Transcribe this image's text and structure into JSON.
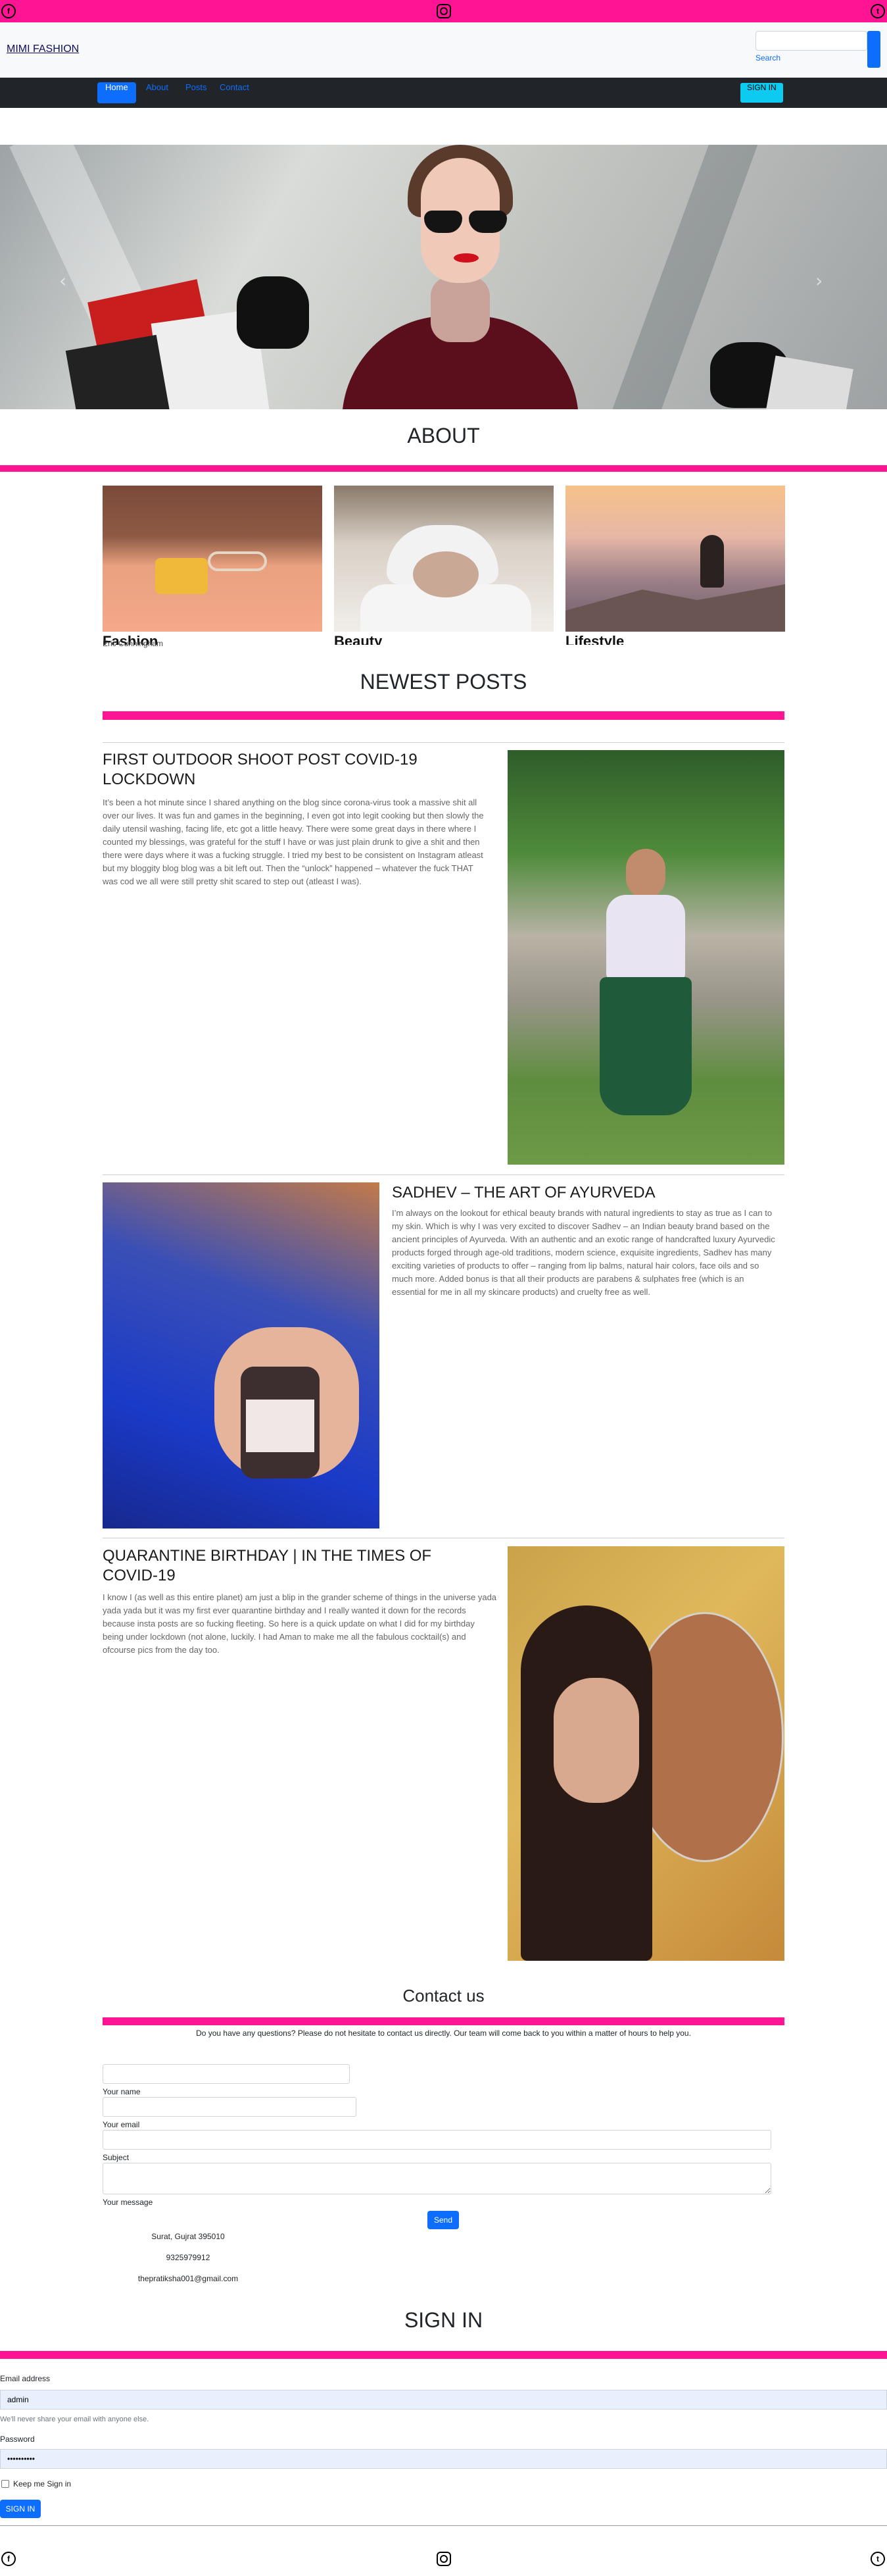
{
  "social": {
    "facebook": "f",
    "twitter": "t"
  },
  "brand": "MIMI FASHION",
  "search": {
    "label": "Search",
    "placeholder": ""
  },
  "nav": {
    "items": [
      "Home",
      "About",
      "Posts",
      "Contact"
    ],
    "signin": "SIGN IN"
  },
  "hero": {
    "prev": "‹",
    "next": "›"
  },
  "about": {
    "title": "ABOUT",
    "cards": [
      {
        "caption": "Fashion",
        "author": "Eric Cunningham"
      },
      {
        "caption": "Beauty",
        "author": ""
      },
      {
        "caption": "Lifestyle",
        "author": ""
      }
    ]
  },
  "posts": {
    "title": "NEWEST POSTS",
    "items": [
      {
        "title": "FIRST OUTDOOR SHOOT POST COVID-19 LOCKDOWN",
        "body": "It’s been a hot minute since I shared anything on the blog since corona-virus took a massive shit all over our lives. It was fun and games in the beginning, I even got into legit cooking but then slowly the daily utensil washing, facing life, etc got a little heavy. There were some great days in there where I counted my blessings, was grateful for the stuff I have or was just plain drunk to give a shit and then there were days where it was a fucking struggle. I tried my best to be consistent on Instagram atleast but my bloggity blog blog was a bit left out. Then the “unlock” happened – whatever the fuck THAT was cod we all were still pretty shit scared to step out (atleast I was)."
      },
      {
        "title": "SADHEV – THE ART OF AYURVEDA",
        "body": "I’m always on the lookout for ethical beauty brands with natural ingredients to stay as true as I can to my skin. Which is why I was very excited to discover Sadhev – an Indian beauty brand based on the ancient principles of Ayurveda. With an authentic and an exotic range of handcrafted luxury Ayurvedic products forged through age-old traditions, modern science, exquisite ingredients, Sadhev has many exciting varieties of products to offer – ranging from lip balms, natural hair colors, face oils and so much more. Added bonus is that all their products are parabens & sulphates free (which is an essential for me in all my skincare products) and cruelty free as well."
      },
      {
        "title": "QUARANTINE BIRTHDAY | IN THE TIMES OF COVID-19",
        "body": "I know I (as well as this entire planet) am just a blip in the grander scheme of things in the universe yada yada yada but it was my first ever quarantine birthday and I really wanted it down for the records because insta posts are so fucking fleeting. So here is a quick update on what I did for my birthday being under lockdown (not alone, luckily. I had Aman to make me all the fabulous cocktail(s) and ofcourse pics from the day too."
      }
    ]
  },
  "contact": {
    "title": "Contact us",
    "subtitle": "Do you have any questions? Please do not hesitate to contact us directly. Our team will come back to you within a matter of hours to help you.",
    "labels": {
      "name": "Your name",
      "email": "Your email",
      "subject": "Subject",
      "message": "Your message"
    },
    "send": "Send",
    "address": "Surat, Gujrat 395010",
    "phone": "9325979912",
    "email": "thepratiksha001@gmail.com"
  },
  "signin": {
    "title": "SIGN IN",
    "email_label": "Email address",
    "email_value": "admin",
    "email_help": "We'll never share your email with anyone else.",
    "password_label": "Password",
    "password_value": "••••••••••",
    "remember": "Keep me Sign in",
    "button": "SIGN IN"
  },
  "colors": {
    "accent": "#ff1493",
    "primary": "#0d6efd",
    "nav_bg": "#212529",
    "info": "#0dcaf0"
  }
}
